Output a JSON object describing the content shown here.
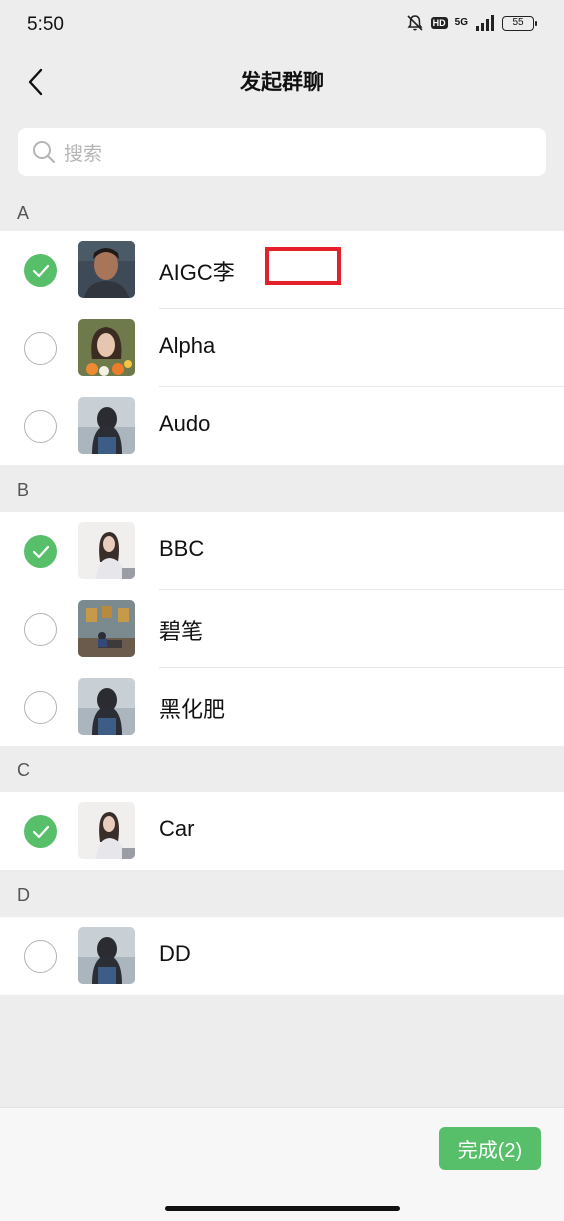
{
  "status_bar": {
    "time": "5:50",
    "hd_label": "HD",
    "network_label": "5G",
    "battery": "55"
  },
  "nav": {
    "title": "发起群聊",
    "back_icon": "chevron-left-icon"
  },
  "search": {
    "placeholder": "搜索",
    "icon": "search-icon"
  },
  "sections": [
    {
      "letter": "A",
      "contacts": [
        {
          "name": "AIGC李",
          "checked": true
        },
        {
          "name": "Alpha",
          "checked": false
        },
        {
          "name": "Audo",
          "checked": false
        }
      ]
    },
    {
      "letter": "B",
      "contacts": [
        {
          "name": "BBC",
          "checked": true
        },
        {
          "name": "碧笔",
          "checked": false
        },
        {
          "name": "黑化肥",
          "checked": false
        }
      ]
    },
    {
      "letter": "C",
      "contacts": [
        {
          "name": "Car",
          "checked": true
        }
      ]
    },
    {
      "letter": "D",
      "contacts": [
        {
          "name": "DD",
          "checked": false
        }
      ]
    }
  ],
  "done_button": {
    "label": "完成(2)"
  },
  "colors": {
    "accent": "#57be6a",
    "background": "#ededed",
    "highlight_box": "#e4202a"
  }
}
